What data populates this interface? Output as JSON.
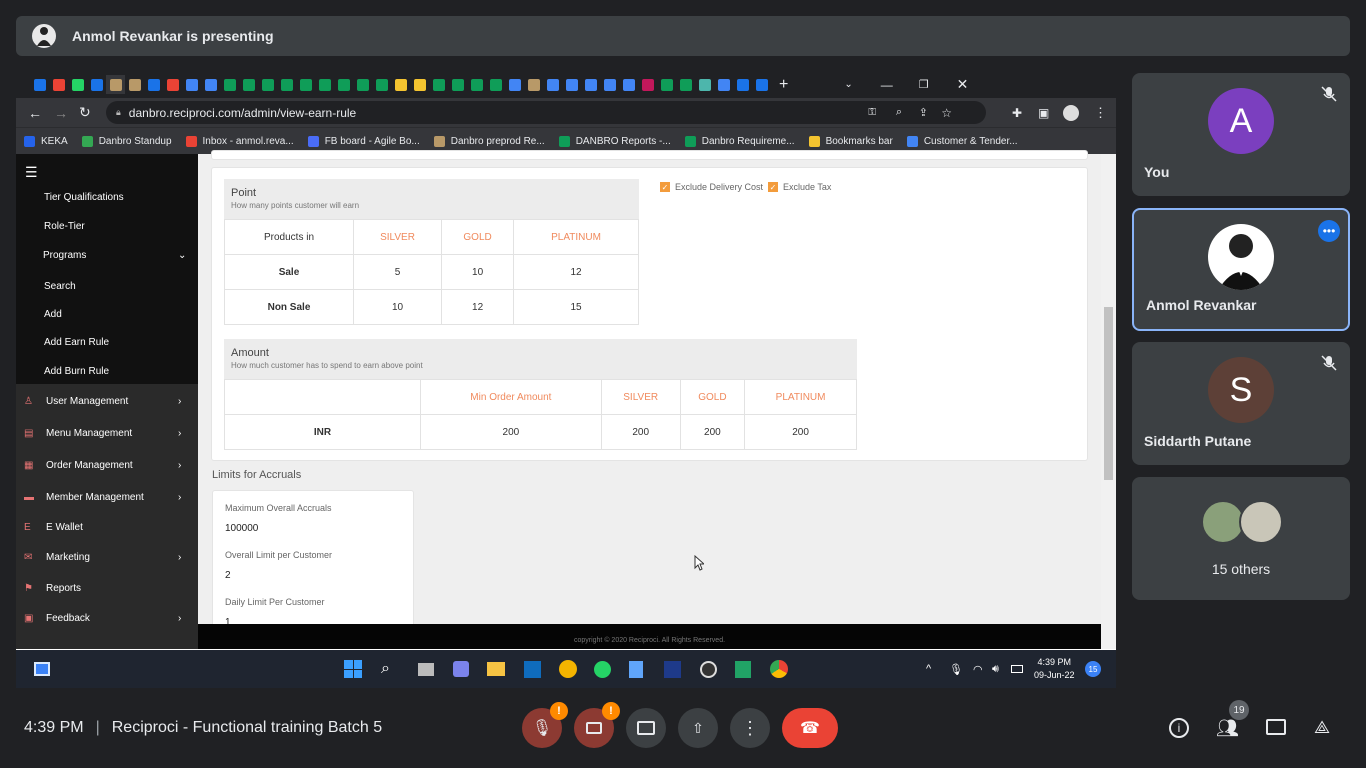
{
  "presenting": {
    "text": "Anmol Revankar is presenting"
  },
  "browser": {
    "url": "danbro.reciproci.com/admin/view-earn-rule",
    "bookmarks": [
      "KEKA",
      "Danbro Standup",
      "Inbox - anmol.reva...",
      "FB board - Agile Bo...",
      "Danbro preprod Re...",
      "DANBRO Reports -...",
      "Danbro Requireme...",
      "Bookmarks bar",
      "Customer & Tender..."
    ]
  },
  "sidebar": {
    "items": [
      "Tier Qualifications",
      "Role-Tier",
      "Programs",
      "Search",
      "Add",
      "Add Earn Rule",
      "Add Burn Rule",
      "User Management",
      "Menu Management",
      "Order Management",
      "Member Management",
      "E Wallet",
      "Marketing",
      "Reports",
      "Feedback"
    ]
  },
  "point": {
    "title": "Point",
    "subtitle": "How many points customer will earn",
    "headers": [
      "Products in",
      "SILVER",
      "GOLD",
      "PLATINUM"
    ],
    "rows": [
      [
        "Sale",
        "5",
        "10",
        "12"
      ],
      [
        "Non Sale",
        "10",
        "12",
        "15"
      ]
    ]
  },
  "exclusions": {
    "delivery": "Exclude Delivery Cost",
    "tax": "Exclude Tax"
  },
  "amount": {
    "title": "Amount",
    "subtitle": "How much customer has to spend to earn above point",
    "headers": [
      "",
      "Min Order Amount",
      "SILVER",
      "GOLD",
      "PLATINUM"
    ],
    "row": [
      "INR",
      "200",
      "200",
      "200",
      "200"
    ]
  },
  "limits": {
    "title": "Limits for Accruals",
    "max_label": "Maximum Overall Accruals",
    "max_value": "100000",
    "overall_label": "Overall Limit per Customer",
    "overall_value": "2",
    "daily_label": "Daily Limit Per Customer",
    "daily_value": "1"
  },
  "footer": {
    "text": "copyright © 2020 Reciproci. All Rights Reserved."
  },
  "taskbar": {
    "time": "4:39 PM",
    "date": "09-Jun-22",
    "notif": "15"
  },
  "participants": {
    "you": {
      "initial": "A",
      "name": "You",
      "color": "#7b3fbf"
    },
    "anmol": {
      "name": "Anmol Revankar"
    },
    "siddarth": {
      "initial": "S",
      "name": "Siddarth Putane",
      "color": "#5d4037"
    },
    "others": {
      "label": "15 others"
    }
  },
  "meeting": {
    "time": "4:39 PM",
    "separator": "|",
    "title": "Reciproci - Functional training Batch 5",
    "people_count": "19"
  }
}
